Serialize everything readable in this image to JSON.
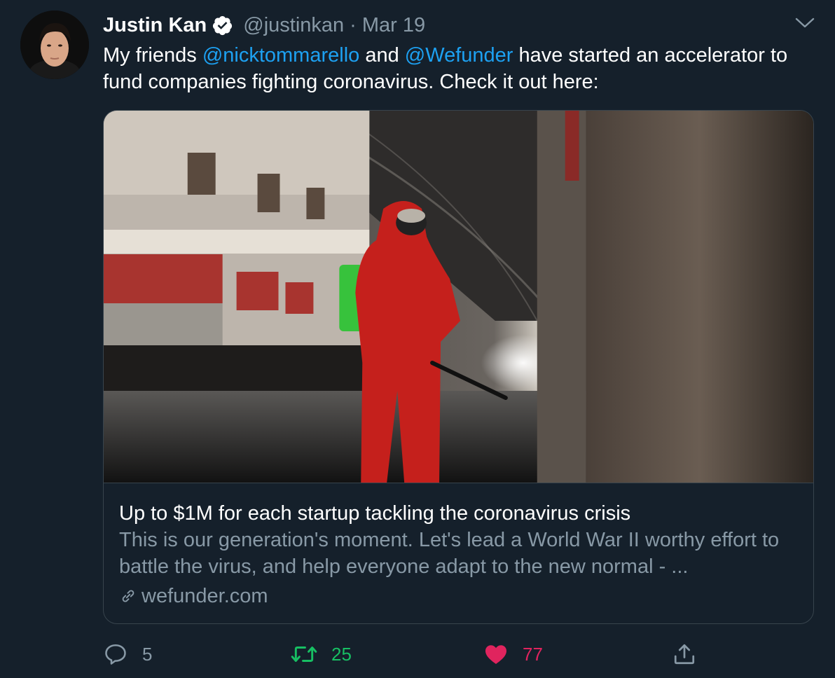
{
  "tweet": {
    "author": {
      "display_name": "Justin Kan",
      "handle": "@justinkan",
      "verified": true
    },
    "separator": "·",
    "date": "Mar 19",
    "text_parts": {
      "t1": "My friends ",
      "mention1": "@nicktommarello",
      "t2": " and ",
      "mention2": "@Wefunder",
      "t3": " have started an accelerator to fund companies fighting coronavirus. Check it out here:"
    },
    "card": {
      "title": "Up to $1M for each startup tackling the coronavirus crisis",
      "description": "This is our generation's moment. Let's lead a World War II worthy effort to battle the virus, and help everyone adapt to the new normal - ...",
      "domain": "wefunder.com"
    },
    "actions": {
      "reply_count": "5",
      "retweet_count": "25",
      "like_count": "77"
    }
  },
  "colors": {
    "background": "#15202b",
    "text": "#ffffff",
    "secondary_text": "#8899a6",
    "link": "#1da1f2",
    "retweet_active": "#17bf63",
    "like_active": "#e0245e",
    "border": "#38444d"
  },
  "icons": {
    "verified": "verified-badge-icon",
    "caret": "chevron-down-icon",
    "reply": "reply-bubble-icon",
    "retweet": "retweet-icon",
    "like": "heart-icon",
    "share": "share-icon",
    "link": "link-icon"
  }
}
